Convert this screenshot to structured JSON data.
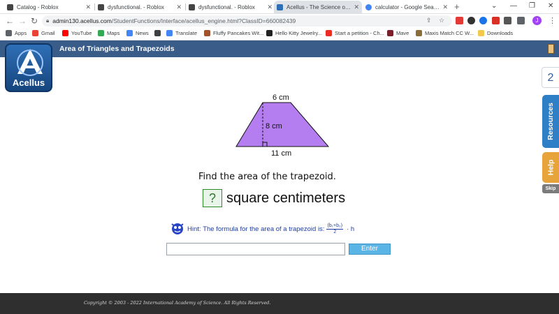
{
  "browser": {
    "tabs": [
      {
        "title": "Catalog - Roblox",
        "favicon_color": "#444444",
        "active": false
      },
      {
        "title": "dysfunctional. - Roblox",
        "favicon_color": "#444444",
        "active": false
      },
      {
        "title": "dysfunctional. - Roblox",
        "favicon_color": "#444444",
        "active": false
      },
      {
        "title": "Acellus - The Science of Lea",
        "favicon_color": "#2f6fb6",
        "active": true
      },
      {
        "title": "calculator - Google Search",
        "favicon_color": "#4285f4",
        "active": false
      }
    ],
    "new_tab_symbol": "+",
    "url_host": "admin130.acellus.com",
    "url_path": "/StudentFunctions/Interface/acellus_engine.html?ClassID=660082439",
    "profile_initial": "J",
    "bookmarks": [
      {
        "label": "Apps",
        "color": "#5f6368"
      },
      {
        "label": "Gmail",
        "color": "#ea4335"
      },
      {
        "label": "YouTube",
        "color": "#ff0000"
      },
      {
        "label": "Maps",
        "color": "#34a853"
      },
      {
        "label": "News",
        "color": "#4285f4"
      },
      {
        "label": "",
        "color": "#3c4043"
      },
      {
        "label": "Translate",
        "color": "#4285f4"
      },
      {
        "label": "Fluffy Pancakes Wit...",
        "color": "#a0522d"
      },
      {
        "label": "Hello Kitty Jewelry...",
        "color": "#222222"
      },
      {
        "label": "Start a petition - Ch...",
        "color": "#ec2c22"
      },
      {
        "label": "Mave",
        "color": "#7a1f2b"
      },
      {
        "label": "Maxis Match CC W...",
        "color": "#8a6d3b"
      },
      {
        "label": "Downloads",
        "color": "#f2c94c"
      }
    ]
  },
  "app": {
    "logo_text": "Acellus",
    "lesson_title": "Area of Triangles and Trapezoids",
    "counter": "2",
    "resources_label": "Resources",
    "help_label": "Help",
    "skip_label": "Skip"
  },
  "problem": {
    "top_base": "6 cm",
    "height": "8 cm",
    "bottom_base": "11 cm",
    "shape_color": "#b57ef0",
    "question": "Find the area of the trapezoid.",
    "blank": "?",
    "units": "square centimeters",
    "hint_label": "Hint:",
    "hint_text": "The formula for the area of a trapezoid is:",
    "hint_numerator": "(b₁+b₂)",
    "hint_denominator": "2",
    "hint_tail": "· h",
    "input_value": "",
    "enter_label": "Enter"
  },
  "footer": {
    "copyright": "Copyright © 2003 - 2022 International Academy of Science. All Rights Reserved."
  }
}
